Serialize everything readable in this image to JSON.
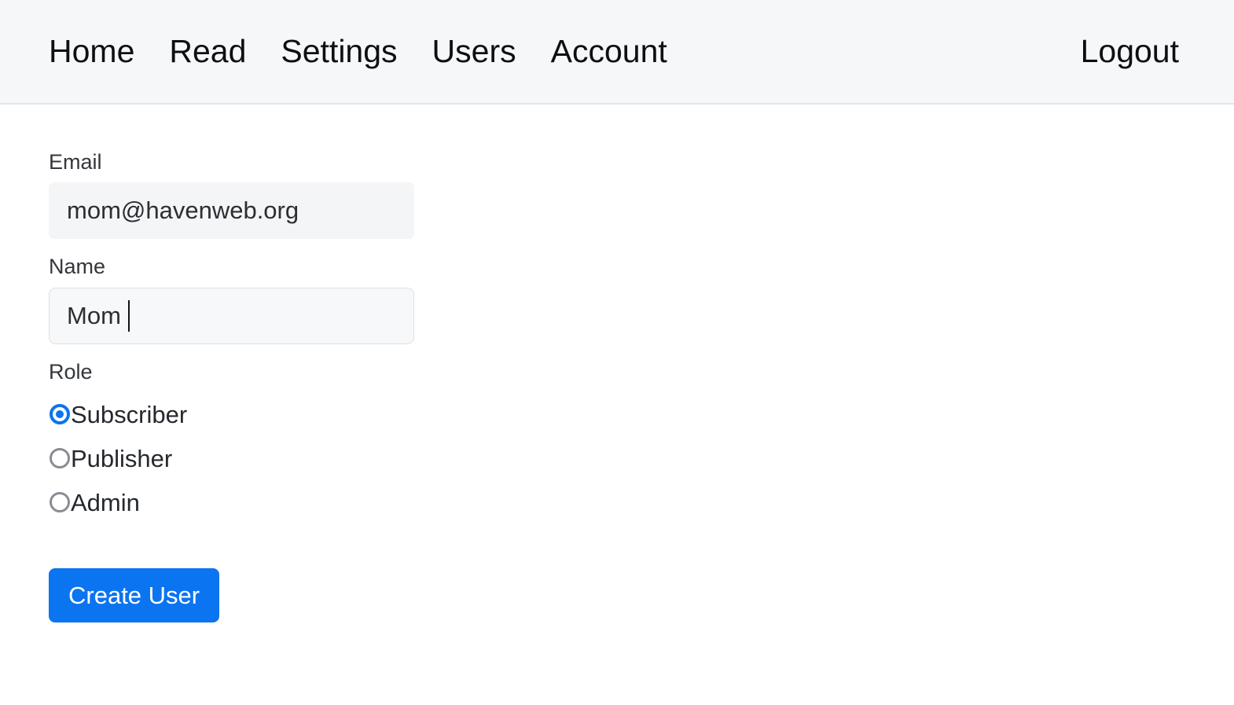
{
  "theme": {
    "accent": "#0b74f0",
    "navbar_bg": "#f6f7f9",
    "navbar_border": "#e3e5e9",
    "page_bg": "#ffffff",
    "input_bg": "#f4f5f7",
    "input_border": "#dfe1e5",
    "label_color": "#33363b",
    "nav_text_color": "#0d0f12",
    "radio_unchecked_color": "#8b8b94"
  },
  "navbar": {
    "links": [
      {
        "label": "Home"
      },
      {
        "label": "Read"
      },
      {
        "label": "Settings"
      },
      {
        "label": "Users"
      },
      {
        "label": "Account"
      }
    ],
    "logout_label": "Logout"
  },
  "form": {
    "email": {
      "label": "Email",
      "value": "mom@havenweb.org",
      "placeholder": "Email"
    },
    "name": {
      "label": "Name",
      "value": "Mom",
      "placeholder": "Name",
      "focused": true
    },
    "role": {
      "label": "Role",
      "selected": "Subscriber",
      "options": [
        {
          "label": "Subscriber",
          "checked": true
        },
        {
          "label": "Publisher",
          "checked": false
        },
        {
          "label": "Admin",
          "checked": false
        }
      ]
    },
    "submit_label": "Create User"
  }
}
